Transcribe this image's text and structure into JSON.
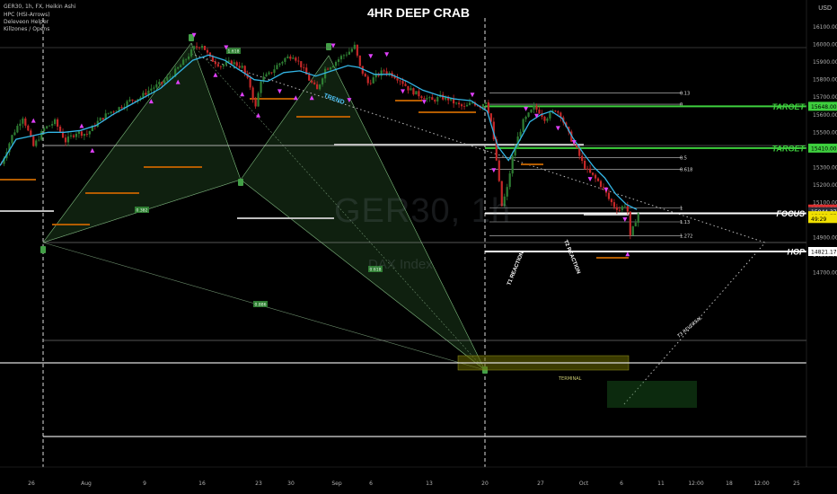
{
  "header": {
    "symbol_line": "GER30, 1h, FX, Heikin Ashi",
    "indicators": [
      "HPC (HSI-Arrows)",
      "Deleveon Helper",
      "Killzones / Opens"
    ],
    "title": "4HR DEEP CRAB",
    "watermark": "GER30, 1h",
    "watermark_sub": "DAX Index",
    "currency": "USD"
  },
  "chart_data": {
    "type": "candlestick",
    "title": "4HR DEEP CRAB",
    "ylim": [
      14650,
      16200
    ],
    "y_ticks": [
      16100,
      16000,
      15900,
      15800,
      15700,
      15600,
      15500,
      15400,
      15300,
      15200,
      15100,
      14900,
      14800,
      14700
    ],
    "x_ticks": [
      "26",
      "Aug",
      "9",
      "16",
      "23",
      "30",
      "Sep",
      "6",
      "13",
      "20",
      "27",
      "Oct",
      "6",
      "11",
      "12:00",
      "18",
      "12:00",
      "25"
    ],
    "price_path": [
      [
        0,
        15320
      ],
      [
        4,
        15480
      ],
      [
        8,
        15590
      ],
      [
        12,
        15420
      ],
      [
        16,
        15520
      ],
      [
        20,
        15560
      ],
      [
        24,
        15450
      ],
      [
        28,
        15500
      ],
      [
        32,
        15490
      ],
      [
        36,
        15560
      ],
      [
        40,
        15610
      ],
      [
        44,
        15640
      ],
      [
        48,
        15680
      ],
      [
        52,
        15700
      ],
      [
        56,
        15750
      ],
      [
        60,
        15780
      ],
      [
        64,
        15830
      ],
      [
        68,
        15900
      ],
      [
        72,
        15980
      ],
      [
        75,
        16000
      ],
      [
        78,
        15920
      ],
      [
        82,
        15880
      ],
      [
        86,
        15900
      ],
      [
        90,
        15870
      ],
      [
        93,
        15760
      ],
      [
        95,
        15640
      ],
      [
        97,
        15800
      ],
      [
        100,
        15830
      ],
      [
        103,
        15880
      ],
      [
        106,
        15920
      ],
      [
        109,
        15940
      ],
      [
        112,
        15880
      ],
      [
        115,
        15800
      ],
      [
        118,
        15740
      ],
      [
        121,
        15860
      ],
      [
        124,
        15890
      ],
      [
        127,
        15930
      ],
      [
        130,
        15960
      ],
      [
        132,
        15990
      ],
      [
        134,
        15870
      ],
      [
        137,
        15780
      ],
      [
        140,
        15820
      ],
      [
        143,
        15850
      ],
      [
        146,
        15830
      ],
      [
        149,
        15800
      ],
      [
        152,
        15750
      ],
      [
        155,
        15720
      ],
      [
        158,
        15700
      ],
      [
        161,
        15680
      ],
      [
        164,
        15700
      ],
      [
        167,
        15690
      ],
      [
        170,
        15660
      ],
      [
        173,
        15640
      ],
      [
        176,
        15670
      ],
      [
        179,
        15650
      ],
      [
        181,
        15680
      ],
      [
        183,
        15560
      ],
      [
        185,
        15340
      ],
      [
        187,
        15080
      ],
      [
        189,
        15180
      ],
      [
        191,
        15360
      ],
      [
        193,
        15470
      ],
      [
        195,
        15560
      ],
      [
        197,
        15600
      ],
      [
        199,
        15640
      ],
      [
        201,
        15620
      ],
      [
        203,
        15580
      ],
      [
        205,
        15600
      ],
      [
        207,
        15630
      ],
      [
        209,
        15600
      ],
      [
        211,
        15520
      ],
      [
        213,
        15460
      ],
      [
        215,
        15400
      ],
      [
        217,
        15330
      ],
      [
        219,
        15280
      ],
      [
        221,
        15250
      ],
      [
        223,
        15220
      ],
      [
        225,
        15180
      ],
      [
        227,
        15120
      ],
      [
        229,
        15080
      ],
      [
        231,
        15060
      ],
      [
        233,
        15090
      ],
      [
        234,
        15050
      ],
      [
        235,
        14900
      ],
      [
        236,
        14950
      ],
      [
        237,
        15000
      ],
      [
        238,
        15040
      ]
    ],
    "trend_line": [
      [
        0,
        15310
      ],
      [
        6,
        15460
      ],
      [
        12,
        15480
      ],
      [
        18,
        15500
      ],
      [
        24,
        15500
      ],
      [
        30,
        15510
      ],
      [
        36,
        15540
      ],
      [
        42,
        15600
      ],
      [
        48,
        15650
      ],
      [
        54,
        15700
      ],
      [
        60,
        15750
      ],
      [
        66,
        15830
      ],
      [
        72,
        15910
      ],
      [
        78,
        15940
      ],
      [
        84,
        15910
      ],
      [
        90,
        15850
      ],
      [
        95,
        15800
      ],
      [
        100,
        15790
      ],
      [
        106,
        15840
      ],
      [
        112,
        15850
      ],
      [
        118,
        15820
      ],
      [
        124,
        15850
      ],
      [
        130,
        15880
      ],
      [
        134,
        15870
      ],
      [
        140,
        15830
      ],
      [
        146,
        15830
      ],
      [
        152,
        15790
      ],
      [
        158,
        15740
      ],
      [
        164,
        15710
      ],
      [
        170,
        15690
      ],
      [
        176,
        15680
      ],
      [
        182,
        15620
      ],
      [
        186,
        15420
      ],
      [
        190,
        15340
      ],
      [
        194,
        15450
      ],
      [
        198,
        15560
      ],
      [
        202,
        15600
      ],
      [
        206,
        15620
      ],
      [
        210,
        15580
      ],
      [
        214,
        15470
      ],
      [
        218,
        15380
      ],
      [
        222,
        15300
      ],
      [
        226,
        15240
      ],
      [
        230,
        15150
      ],
      [
        234,
        15090
      ],
      [
        238,
        15060
      ]
    ],
    "horizontal_levels": [
      {
        "value": 15648,
        "label": "TARGET",
        "color": "#3ecf3e"
      },
      {
        "value": 15410,
        "label": "TARGET",
        "color": "#3ecf3e"
      },
      {
        "value": 15038.77,
        "label": "FOCUS",
        "color": "#ffffff"
      },
      {
        "value": 14821.17,
        "label": "HOP",
        "color": "#ffffff"
      }
    ],
    "price_tags": [
      {
        "value": 15648.0,
        "text": "15648.00",
        "bg": "#3ecf3e",
        "fg": "#000000"
      },
      {
        "value": 15410.0,
        "text": "15410.00",
        "bg": "#3ecf3e",
        "fg": "#000000"
      },
      {
        "value": 15063,
        "text": "15044.38",
        "bg": "#e03030",
        "fg": "#ffffff"
      },
      {
        "value": 15048,
        "text": "15044.37",
        "bg": "#2a2e39",
        "fg": "#ffffff"
      },
      {
        "value": 15025,
        "text": "15038.77",
        "bg": "#f0e000",
        "fg": "#000000"
      },
      {
        "value": 15009,
        "text": "49:29",
        "bg": "#f0e000",
        "fg": "#000000"
      },
      {
        "value": 14821.17,
        "text": "14821.17",
        "bg": "#ffffff",
        "fg": "#000000"
      }
    ],
    "fib_levels": [
      {
        "label": "0.13",
        "value": 15725
      },
      {
        "label": "0",
        "value": 15660
      },
      {
        "label": "0.5",
        "value": 15355
      },
      {
        "label": "0.618",
        "value": 15290
      },
      {
        "label": "1",
        "value": 15070
      },
      {
        "label": "1.13",
        "value": 14990
      },
      {
        "label": "1.272",
        "value": 14910
      }
    ],
    "pattern_labels": [
      "0.382",
      "0.886",
      "0.618",
      "1.618"
    ],
    "annotations": [
      "TREND",
      "T1 REACTION",
      "T2 REACTION",
      "TERMINAL",
      "T3 REVERSAL",
      "0.5"
    ],
    "colors": {
      "background": "#000000",
      "trend": "#33b5e5",
      "candle_up": "#2e7d32",
      "candle_down": "#c62828",
      "marker": "#e040fb",
      "harmonic": "#1b3a1b",
      "target": "#3ecf3e"
    }
  }
}
